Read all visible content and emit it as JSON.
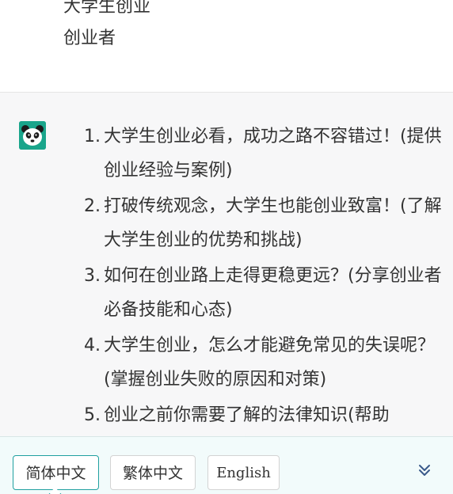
{
  "user_message": {
    "lines": [
      "大学生创业",
      "创业者"
    ]
  },
  "assistant_message": {
    "avatar_icon": "panda-icon",
    "avatar_color": "#19a58b",
    "items": [
      {
        "num": "1.",
        "text": "大学生创业必看，成功之路不容错过！(提供创业经验与案例)"
      },
      {
        "num": "2.",
        "text": "打破传统观念，大学生也能创业致富！(了解大学生创业的优势和挑战)"
      },
      {
        "num": "3.",
        "text": "如何在创业路上走得更稳更远？(分享创业者必备技能和心态)"
      },
      {
        "num": "4.",
        "text": "大学生创业，怎么才能避免常见的失误呢？(掌握创业失败的原因和对策)"
      },
      {
        "num": "5.",
        "text": "创业之前你需要了解的法律知识(帮助"
      }
    ]
  },
  "language_bar": {
    "options": [
      "简体中文",
      "繁体中文",
      "English"
    ],
    "selected": "简体中文",
    "accent_color": "#20a0a0",
    "expand_icon": "double-chevron-down-icon"
  }
}
